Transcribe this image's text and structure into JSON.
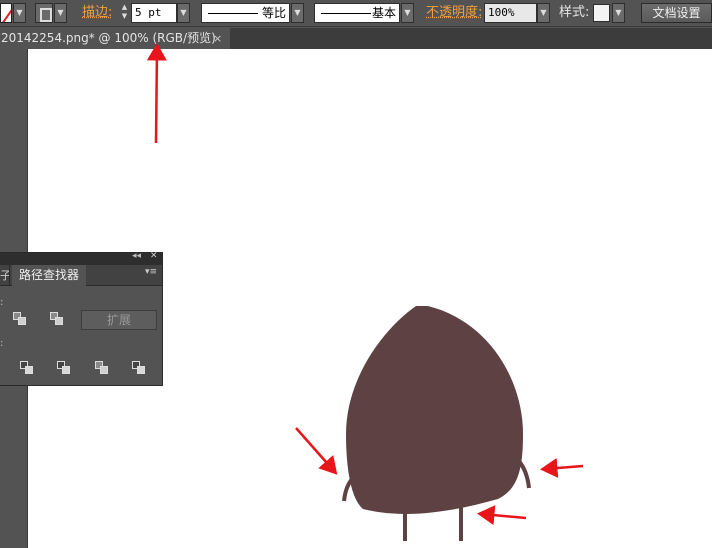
{
  "toolbar": {
    "stroke_label": "描边:",
    "stroke_weight": "5 pt",
    "profile_label": "等比",
    "brush_label": "基本",
    "opacity_label": "不透明度:",
    "opacity_value": "100%",
    "style_label": "样式:",
    "doc_setup_button": "文档设置"
  },
  "document_tab": {
    "title": "20142254.png* @ 100% (RGB/预览)",
    "close_glyph": "×"
  },
  "pathfinder_panel": {
    "partial_tab": "子",
    "active_tab": "路径查找器",
    "collapse_glyph": "◂◂",
    "close_glyph": "✕",
    "menu_glyph": "▾≡",
    "expand_button": "扩展"
  },
  "canvas": {
    "shape_color": "#5e4143",
    "arrow_color": "#e8151a"
  }
}
